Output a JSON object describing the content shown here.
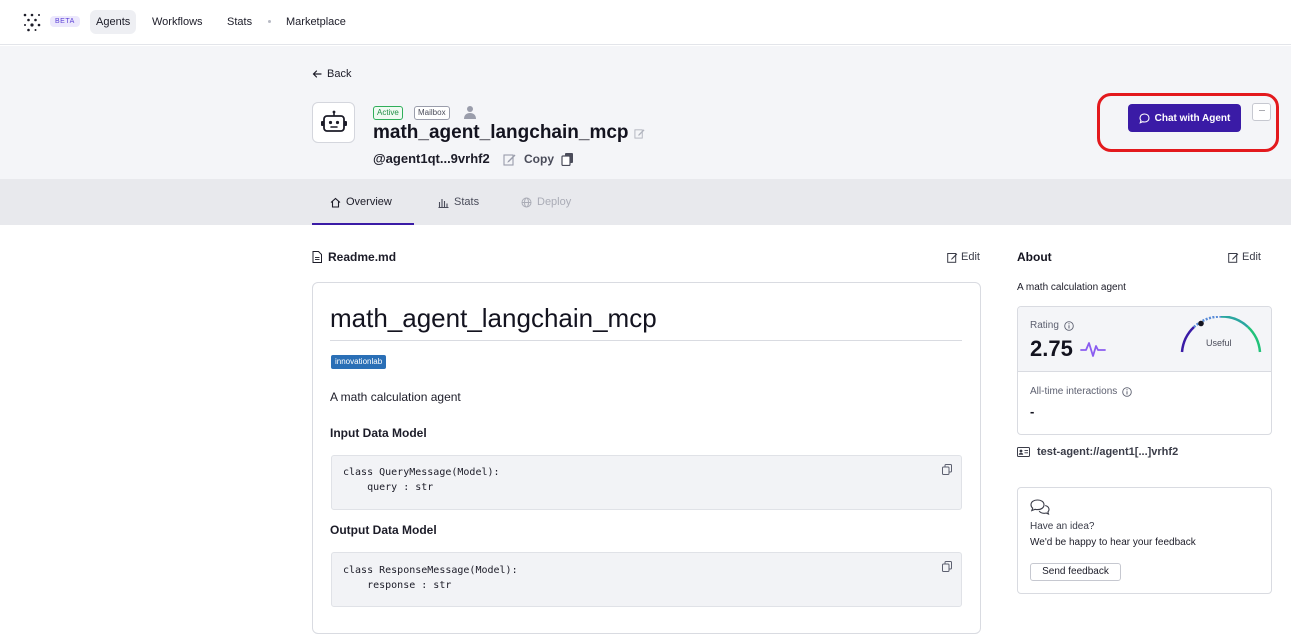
{
  "nav": {
    "beta": "BETA",
    "items": [
      {
        "label": "Agents",
        "active": true
      },
      {
        "label": "Workflows"
      },
      {
        "label": "Stats"
      },
      {
        "label": "Marketplace"
      }
    ]
  },
  "header": {
    "back_label": "Back",
    "badges": {
      "active": "Active",
      "mailbox": "Mailbox"
    },
    "agent_name": "math_agent_langchain_mcp",
    "agent_handle": "@agent1qt...9vrhf2",
    "copy_label": "Copy",
    "chat_button_label": "Chat with Agent",
    "more_label": "···"
  },
  "tabs": [
    {
      "label": "Overview",
      "icon": "home-icon",
      "active": true
    },
    {
      "label": "Stats",
      "icon": "bar-chart-icon"
    },
    {
      "label": "Deploy",
      "icon": "globe-icon",
      "disabled": true
    }
  ],
  "readme": {
    "file_label": "Readme.md",
    "edit_label": "Edit",
    "title": "math_agent_langchain_mcp",
    "tag": "innovationlab",
    "description": "A math calculation agent",
    "input_heading": "Input Data Model",
    "input_code": [
      "class QueryMessage(Model):",
      "    query : str"
    ],
    "output_heading": "Output Data Model",
    "output_code": [
      "class ResponseMessage(Model):",
      "    response : str"
    ]
  },
  "about": {
    "title": "About",
    "edit_label": "Edit",
    "description": "A math calculation agent",
    "rating_label": "Rating",
    "rating_value": "2.75",
    "gauge_label": "Useful",
    "interactions_label": "All-time interactions",
    "interactions_value": "-",
    "address": "test-agent://agent1[...]vrhf2"
  },
  "feedback": {
    "question": "Have an idea?",
    "text": "We'd be happy to hear your feedback",
    "button_label": "Send feedback"
  },
  "colors": {
    "accent": "#3a1ba6",
    "highlight_ring": "#e3191d",
    "active_badge": "#2fae5a",
    "tag": "#2a6fb6"
  }
}
